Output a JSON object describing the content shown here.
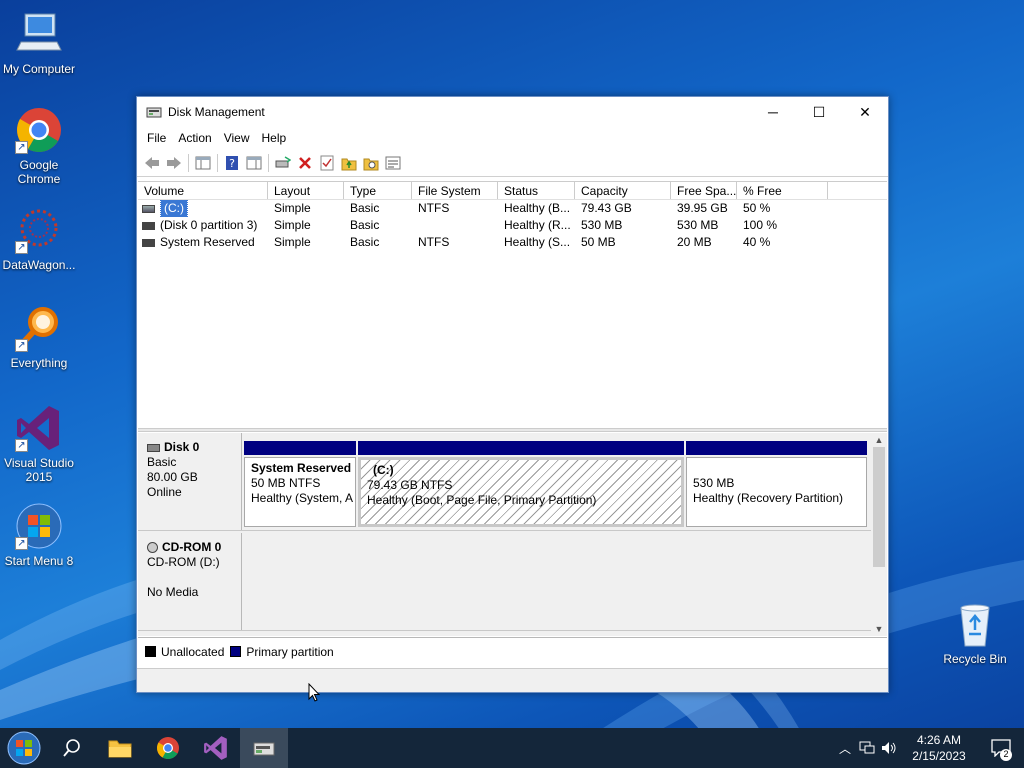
{
  "desktop": {
    "icons": [
      {
        "label": "My Computer"
      },
      {
        "label": "Google Chrome"
      },
      {
        "label": "DataWagon..."
      },
      {
        "label": "Everything"
      },
      {
        "label": "Visual Studio 2015"
      },
      {
        "label": "Start Menu 8"
      },
      {
        "label": "Recycle Bin"
      }
    ]
  },
  "window": {
    "title": "Disk Management",
    "controls": {
      "minimize": "─",
      "maximize": "☐",
      "close": "✕"
    },
    "menu": [
      "File",
      "Action",
      "View",
      "Help"
    ],
    "columns": [
      "Volume",
      "Layout",
      "Type",
      "File System",
      "Status",
      "Capacity",
      "Free Spa...",
      "% Free"
    ],
    "volumes": [
      {
        "volume": "(C:)",
        "layout": "Simple",
        "type": "Basic",
        "fs": "NTFS",
        "status": "Healthy (B...",
        "capacity": "79.43 GB",
        "free": "39.95 GB",
        "pct": "50 %"
      },
      {
        "volume": "(Disk 0 partition 3)",
        "layout": "Simple",
        "type": "Basic",
        "fs": "",
        "status": "Healthy (R...",
        "capacity": "530 MB",
        "free": "530 MB",
        "pct": "100 %"
      },
      {
        "volume": "System Reserved",
        "layout": "Simple",
        "type": "Basic",
        "fs": "NTFS",
        "status": "Healthy (S...",
        "capacity": "50 MB",
        "free": "20 MB",
        "pct": "40 %"
      }
    ],
    "disks": [
      {
        "name": "Disk 0",
        "kind": "Basic",
        "size": "80.00 GB",
        "state": "Online",
        "partitions": [
          {
            "name": "System Reserved",
            "size": "50 MB NTFS",
            "status": "Healthy (System, A"
          },
          {
            "name": "(C:)",
            "size": "79.43 GB NTFS",
            "status": "Healthy (Boot, Page File, Primary Partition)"
          },
          {
            "name": "",
            "size": "530 MB",
            "status": "Healthy (Recovery Partition)"
          }
        ]
      },
      {
        "name": "CD-ROM 0",
        "kind": "CD-ROM (D:)",
        "state": "No Media"
      }
    ],
    "legend": [
      "Unallocated",
      "Primary partition"
    ],
    "colors": {
      "unallocated": "#000000",
      "primary": "#000080"
    }
  },
  "taskbar": {
    "time": "4:26 AM",
    "date": "2/15/2023",
    "notifications": "2"
  }
}
